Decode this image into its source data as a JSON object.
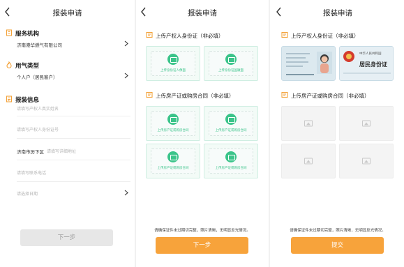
{
  "screens": [
    {
      "title": "报装申请",
      "sections": {
        "org": {
          "title": "服务机构",
          "value": "济南港华燃气有限公司"
        },
        "gas": {
          "title": "用气类型",
          "value": "个人户（居民客户）"
        },
        "info": {
          "title": "报装信息",
          "name_placeholder": "请填写产权人真实姓名",
          "id_placeholder": "请填写产权人身份证号",
          "district": "济南市历下区",
          "address_placeholder": "请填写详细地址",
          "phone_placeholder": "请填写联系电话",
          "select_placeholder": "请选择日期"
        }
      },
      "next_button": "下一步"
    },
    {
      "title": "报装申请",
      "id_section_title": "上传产权人身份证（非必填）",
      "id_front_label": "上传身份证人像面",
      "id_back_label": "上传身份证国徽面",
      "property_section_title": "上传房产证或购房合同（非必填）",
      "property_slot_labels": [
        "上传房产证或购房合同",
        "上传房产证或购房合同",
        "上传房产证或购房合同",
        "上传房产证或购房合同"
      ],
      "hint": "请确保证件未过期切完整，照片清晰，无明显反光情况。",
      "next_button": "下一步"
    },
    {
      "title": "报装申请",
      "id_section_title": "上传产权人身份证（非必填）",
      "id_back_text": "居民身份证",
      "id_back_country": "中华人民共和国",
      "property_section_title": "上传房产证或购房合同（非必填）",
      "hint": "请确保证件未过期切完整，照片清晰，无明显反光情况。",
      "submit_button": "提交"
    }
  ],
  "colors": {
    "accent": "#f7a33b",
    "green": "#3bc48a",
    "icon_orange": "#f3a23a"
  }
}
